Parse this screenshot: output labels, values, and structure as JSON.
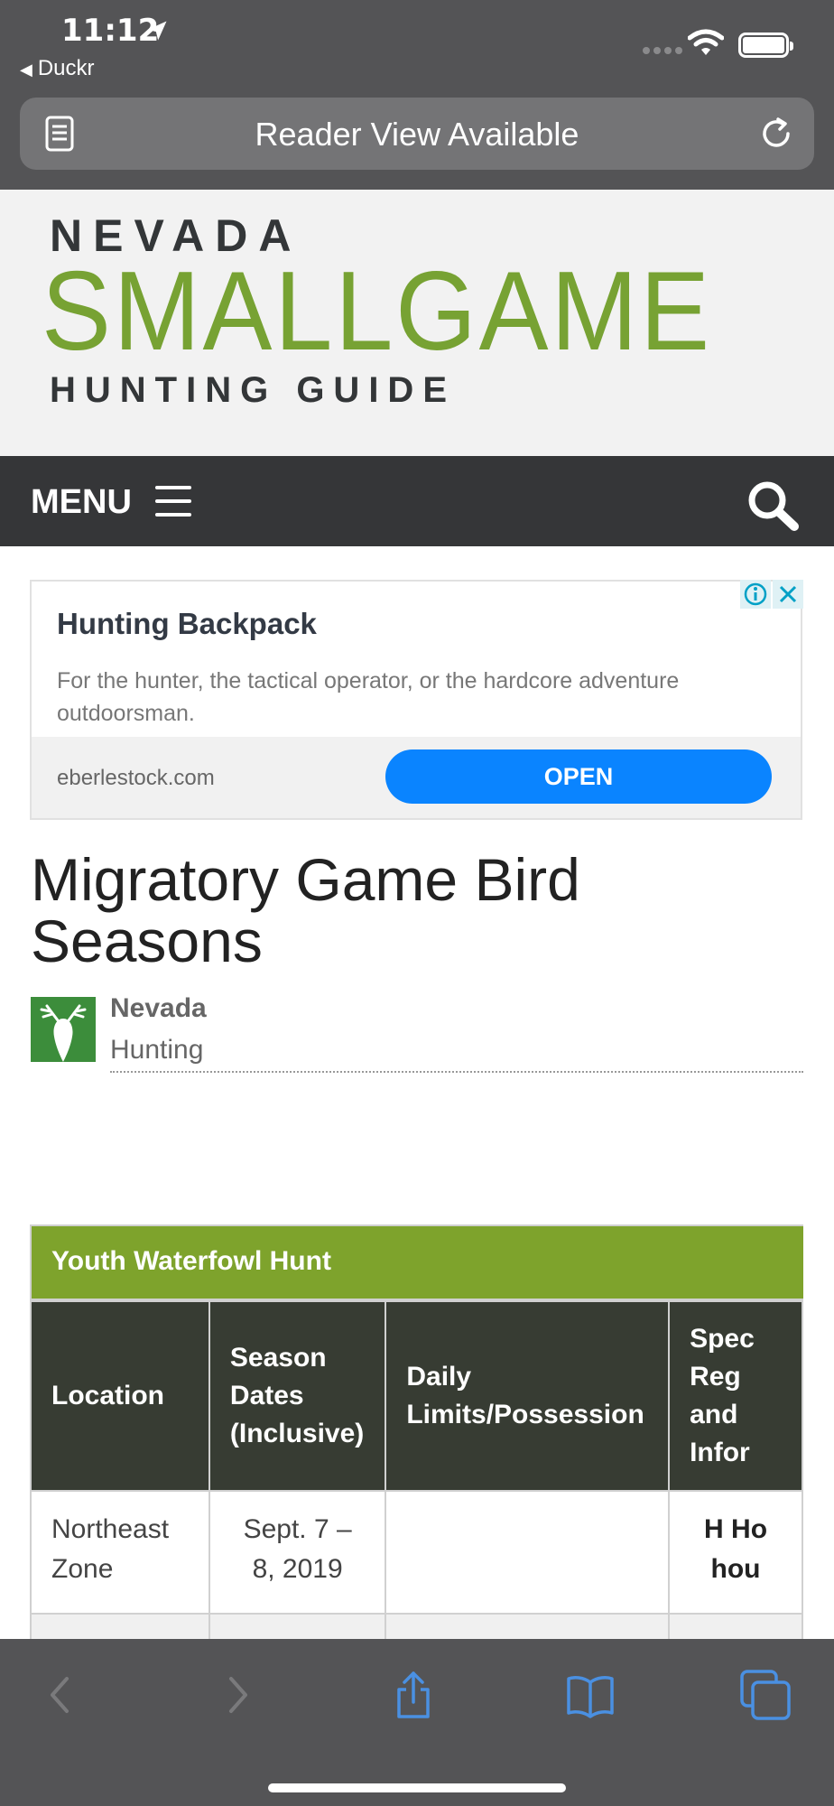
{
  "status_bar": {
    "time": "11:12",
    "back_app": "Duckr"
  },
  "url_bar": {
    "text": "Reader View Available"
  },
  "site": {
    "logo_line1": "NEVADA",
    "logo_line2": "SMALLGAME",
    "logo_line3": "HUNTING GUIDE",
    "menu_label": "MENU"
  },
  "ad": {
    "title": "Hunting Backpack",
    "description": "For the hunter, the tactical operator, or the hardcore adventure outdoorsman.",
    "domain": "eberlestock.com",
    "cta": "OPEN"
  },
  "article": {
    "title": "Migratory Game Bird Seasons",
    "author_name": "Nevada",
    "author_sub": "Hunting"
  },
  "table": {
    "caption": "Youth Waterfowl Hunt",
    "headers": [
      "Location",
      "Season Dates (Inclusive)",
      "Daily Limits/Possession",
      "Spec Reg and Infor"
    ],
    "rows": [
      [
        "Northeast Zone",
        "Sept. 7 – 8, 2019",
        "",
        "H Ho hou"
      ]
    ]
  },
  "colors": {
    "chrome": "#545456",
    "brand_green": "#77a233",
    "menu_bar": "#353638",
    "table_header": "#373c33",
    "caption_bg": "#7ea32c",
    "ad_button": "#0a84ff",
    "toolbar_icon": "#4a90e2"
  }
}
